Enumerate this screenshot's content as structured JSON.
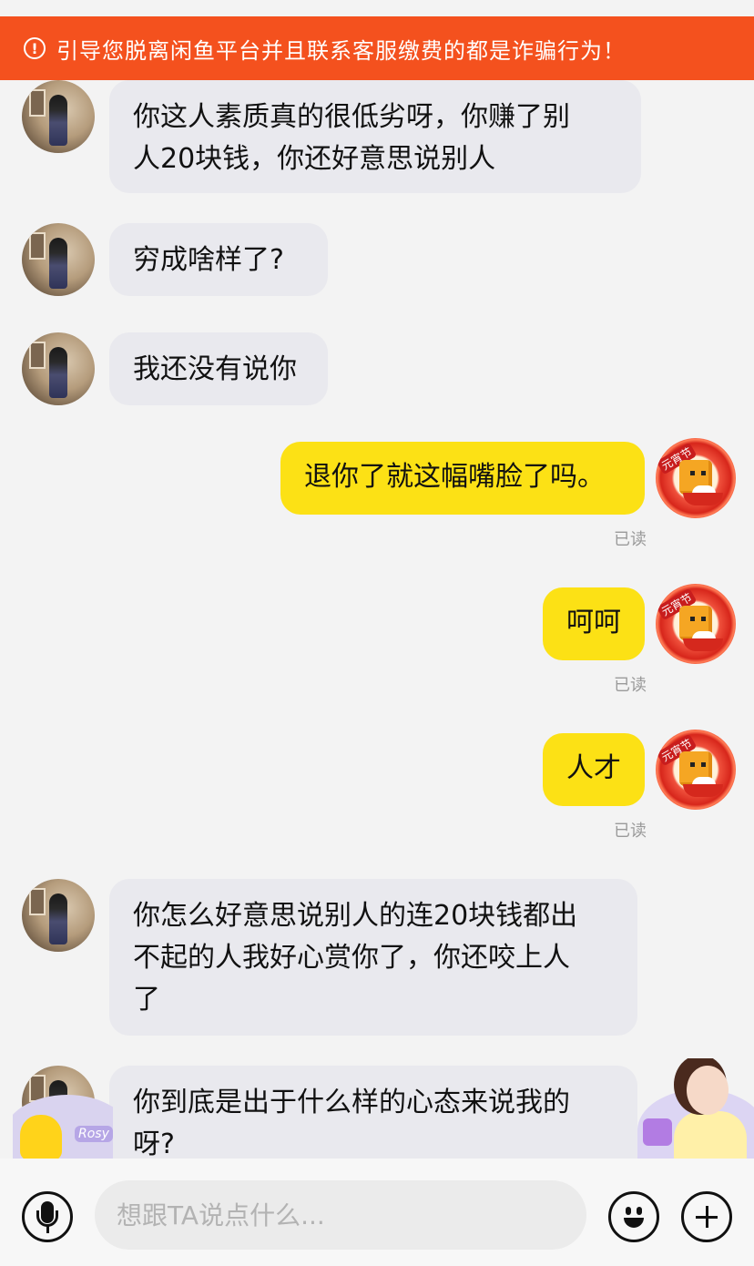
{
  "banner": {
    "icon": "warning-circle-icon",
    "text": "引导您脱离闲鱼平台并且联系客服缴费的都是诈骗行为！"
  },
  "messages": [
    {
      "side": "left",
      "lines": [
        "你这人素质真的很低劣呀，你赚了别",
        "人20块钱，你还好意思说别人"
      ]
    },
    {
      "side": "left",
      "lines": [
        "穷成啥样了?"
      ]
    },
    {
      "side": "left",
      "lines": [
        "我还没有说你"
      ]
    },
    {
      "side": "right",
      "text": "退你了就这幅嘴脸了吗。",
      "status": "已读"
    },
    {
      "side": "right",
      "text": "呵呵",
      "status": "已读"
    },
    {
      "side": "right",
      "text": "人才",
      "status": "已读"
    },
    {
      "side": "left",
      "lines": [
        "你怎么好意思说别人的连20块钱都出",
        "不起的人我好心赏你了，你还咬上人",
        "了"
      ]
    },
    {
      "side": "left",
      "lines": [
        "你到底是出于什么样的心态来说我的",
        "呀?"
      ]
    }
  ],
  "my_avatar_badge": "元宵节",
  "ad_left_tag": "Rosy",
  "input": {
    "placeholder": "想跟TA说点什么...",
    "value": ""
  },
  "icons": {
    "voice": "microphone-icon",
    "emoji": "smiley-icon",
    "more": "plus-icon"
  },
  "colors": {
    "banner": "#f4511e",
    "my_bubble": "#fce115",
    "their_bubble": "#e9e9ee",
    "background": "#f3f3f3"
  }
}
